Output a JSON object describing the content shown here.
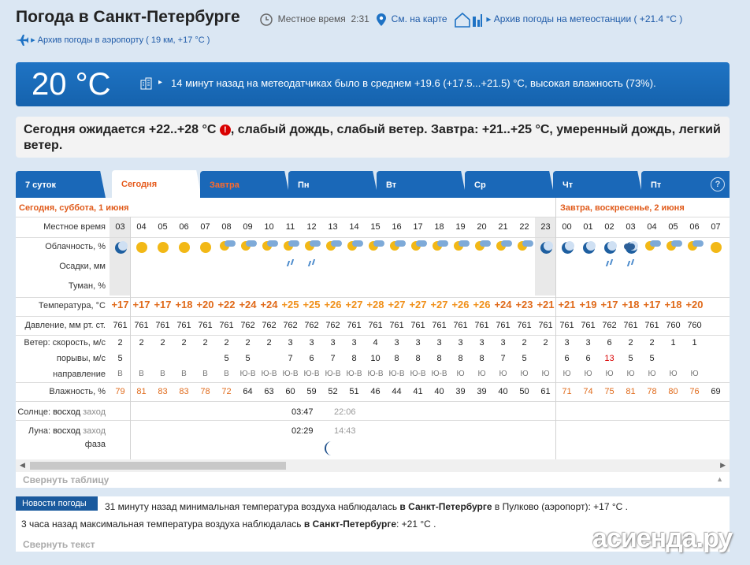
{
  "header": {
    "title": "Погода в Санкт-Петербурге",
    "local_time_label": "Местное время",
    "local_time_value": "2:31",
    "map_link": "См. на карте",
    "archive_station": "Архив погоды на метеостанции ( +21.4 °C )",
    "archive_airport": "Архив погоды в аэропорту ( 19 км, +17 °C )"
  },
  "current": {
    "temp": "20 °C",
    "text": "14 минут назад на метеодатчиках было в среднем +19.6 (+17.5...+21.5) °C, высокая влажность (73%)."
  },
  "forecast": {
    "part1": "Сегодня ожидается +22..+28 °C",
    "warn_icon": "!",
    "part2": ", слабый дождь, слабый ветер. Завтра: +21..+25 °C, умеренный дождь, легкий ветер."
  },
  "tabs": [
    "7 суток",
    "Сегодня",
    "Завтра",
    "Пн",
    "Вт",
    "Ср",
    "Чт",
    "Пт"
  ],
  "help_icon": "?",
  "days": {
    "today": "Сегодня, суббота, 1 июня",
    "tomorrow": "Завтра, воскресенье, 2 июня"
  },
  "labels": {
    "time": "Местное время",
    "clouds": "Облачность, %",
    "precip": "Осадки, мм",
    "fog": "Туман, %",
    "temp": "Температура, °С",
    "pressure": "Давление, мм рт. ст.",
    "wind": "Ветер: скорость, м/с",
    "gusts": "порывы, м/с",
    "direction": "направление",
    "humidity": "Влажность, %",
    "sun_a": "Солнце:",
    "sun_b": "восход",
    "sun_c": "заход",
    "moon_a": "Луна:",
    "moon_b": "восход",
    "moon_c": "заход",
    "phase": "фаза"
  },
  "hours": [
    "03",
    "04",
    "05",
    "06",
    "07",
    "08",
    "09",
    "10",
    "11",
    "12",
    "13",
    "14",
    "15",
    "16",
    "17",
    "18",
    "19",
    "20",
    "21",
    "22",
    "23",
    "00",
    "01",
    "02",
    "03",
    "04",
    "05",
    "06",
    "07"
  ],
  "cloud_icons": [
    "moon-clear",
    "sun",
    "sun",
    "sun",
    "sun",
    "sun-cloud",
    "sun-cloud",
    "sun-cloud",
    "sun-cloud-rain",
    "sun-cloud",
    "sun-cloud",
    "sun-cloud",
    "sun-cloud",
    "sun-cloud",
    "sun-cloud",
    "sun-cloud",
    "sun-cloud",
    "sun-cloud",
    "sun-cloud",
    "sun-cloud",
    "moon-clear",
    "moon-clear",
    "moon-clear",
    "moon-clear",
    "moon-cloud-rain",
    "sun-cloud",
    "sun-cloud",
    "sun-cloud",
    "sun"
  ],
  "rain_cols": [
    8,
    9,
    23,
    24
  ],
  "temps": [
    "+17",
    "+17",
    "+17",
    "+18",
    "+20",
    "+22",
    "+24",
    "+24",
    "+25",
    "+25",
    "+26",
    "+27",
    "+28",
    "+27",
    "+27",
    "+27",
    "+26",
    "+26",
    "+24",
    "+23",
    "+21",
    "+21",
    "+19",
    "+17",
    "+18",
    "+17",
    "+18",
    "+20"
  ],
  "pressure": [
    "761",
    "761",
    "761",
    "761",
    "761",
    "761",
    "762",
    "762",
    "762",
    "762",
    "762",
    "761",
    "761",
    "761",
    "761",
    "761",
    "761",
    "761",
    "761",
    "761",
    "761",
    "761",
    "761",
    "762",
    "761",
    "761",
    "760",
    "760"
  ],
  "wind": [
    "2",
    "2",
    "2",
    "2",
    "2",
    "2",
    "2",
    "2",
    "3",
    "3",
    "3",
    "3",
    "4",
    "3",
    "3",
    "3",
    "3",
    "3",
    "3",
    "2",
    "2",
    "3",
    "3",
    "6",
    "2",
    "2",
    "1",
    "1"
  ],
  "gusts": [
    "5",
    "",
    "",
    "",
    "",
    "5",
    "5",
    "",
    "7",
    "6",
    "7",
    "8",
    "10",
    "8",
    "8",
    "8",
    "8",
    "8",
    "7",
    "5",
    "",
    "6",
    "6",
    "13",
    "5",
    "5",
    "",
    ""
  ],
  "direction": [
    "В",
    "В",
    "В",
    "В",
    "В",
    "В",
    "Ю-В",
    "Ю-В",
    "Ю-В",
    "Ю-В",
    "Ю-В",
    "Ю-В",
    "Ю-В",
    "Ю-В",
    "Ю-В",
    "Ю-В",
    "Ю",
    "Ю",
    "Ю",
    "Ю",
    "Ю",
    "Ю",
    "Ю",
    "Ю",
    "Ю",
    "Ю",
    "Ю",
    "Ю"
  ],
  "humidity": [
    "79",
    "81",
    "83",
    "83",
    "78",
    "72",
    "64",
    "63",
    "60",
    "59",
    "52",
    "51",
    "46",
    "44",
    "41",
    "40",
    "39",
    "39",
    "40",
    "50",
    "61",
    "71",
    "74",
    "75",
    "81",
    "78",
    "80",
    "76",
    "69"
  ],
  "sun": {
    "rise": "03:47",
    "set": "22:06"
  },
  "moon": {
    "rise": "02:29",
    "set": "14:43"
  },
  "collapse_table": "Свернуть таблицу",
  "news": {
    "label": "Новости погоды",
    "line1_a": "31 минуту назад минимальная температура воздуха наблюдалась ",
    "line1_b": "в Санкт-Петербурге",
    "line1_c": " в Пулково (аэропорт): +17 ",
    "line1_unit": "°C .",
    "line2_a": "3 часа назад максимальная температура воздуха наблюдалась ",
    "line2_b": "в Санкт-Петербурге",
    "line2_c": ": +21 ",
    "line2_unit": "°C .",
    "collapse": "Свернуть текст"
  },
  "watermark": "асиенда.ру",
  "colors": {
    "warm": "#e06a1a",
    "hot": "#f0901a",
    "blue": "#1a68b8",
    "gust_red": "#d90000"
  }
}
